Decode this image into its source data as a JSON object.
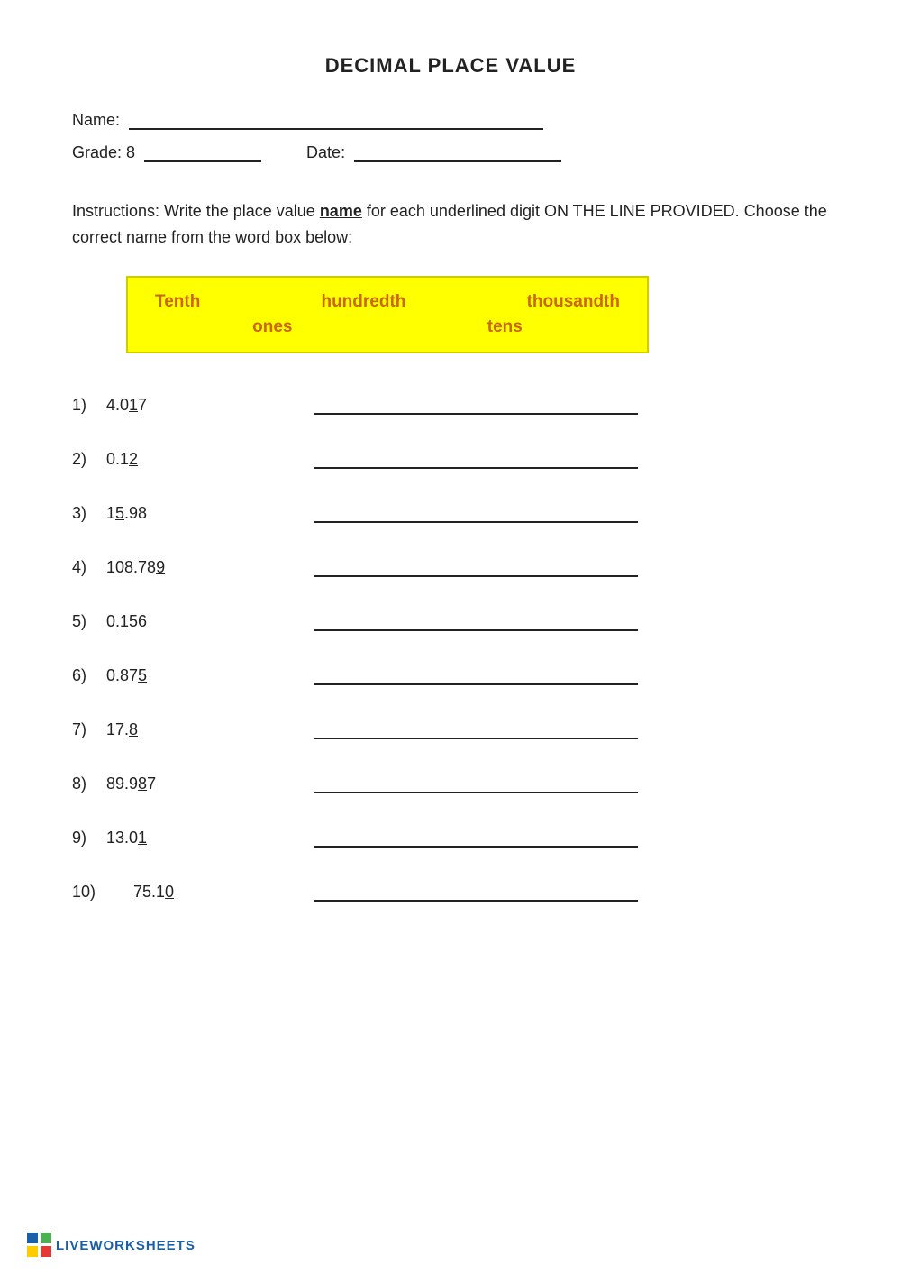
{
  "title": "DECIMAL PLACE VALUE",
  "form": {
    "name_label": "Name:",
    "grade_label": "Grade: 8",
    "date_label": "Date:"
  },
  "instructions": {
    "text_before": "Instructions: Write the place value ",
    "underlined_word": "name",
    "text_after": " for each underlined digit ON THE LINE PROVIDED. Choose the correct name from the word box below:"
  },
  "word_box": {
    "row1": [
      "Tenth",
      "hundredth",
      "thousandth"
    ],
    "row2": [
      "ones",
      "tens"
    ]
  },
  "questions": [
    {
      "number": "1)",
      "display": "4.0<u>1</u>7",
      "underlined_part": "1",
      "prefix": "4.0",
      "suffix": "7"
    },
    {
      "number": "2)",
      "display": "0.1<u>2</u>",
      "underlined_part": "2",
      "prefix": "0.1",
      "suffix": ""
    },
    {
      "number": "3)",
      "display": "1<u>5</u>.98",
      "underlined_part": "5",
      "prefix": "1",
      "suffix": ".98"
    },
    {
      "number": "4)",
      "display": "108.78<u>9</u>",
      "underlined_part": "9",
      "prefix": "108.78",
      "suffix": ""
    },
    {
      "number": "5)",
      "display": "0.<u>1</u>56",
      "underlined_part": "1",
      "prefix": "0.",
      "suffix": "56"
    },
    {
      "number": "6)",
      "display": "0.87<u>5</u>",
      "underlined_part": "5",
      "prefix": "0.87",
      "suffix": ""
    },
    {
      "number": "7)",
      "display": "17.<u>8</u>",
      "underlined_part": "8",
      "prefix": "17.",
      "suffix": ""
    },
    {
      "number": "8)",
      "display": "89.9<u>8</u>7",
      "underlined_part": "8",
      "prefix": "89.9",
      "suffix": "7"
    },
    {
      "number": "9)",
      "display": "13.0<u>1</u>",
      "underlined_part": "1",
      "prefix": "13.0",
      "suffix": ""
    },
    {
      "number": "10)",
      "display": "75.1<u>0</u>",
      "underlined_part": "0",
      "prefix": "75.1",
      "suffix": "",
      "indent": true
    }
  ],
  "footer": {
    "brand": "LIVEWORKSHEETS"
  }
}
